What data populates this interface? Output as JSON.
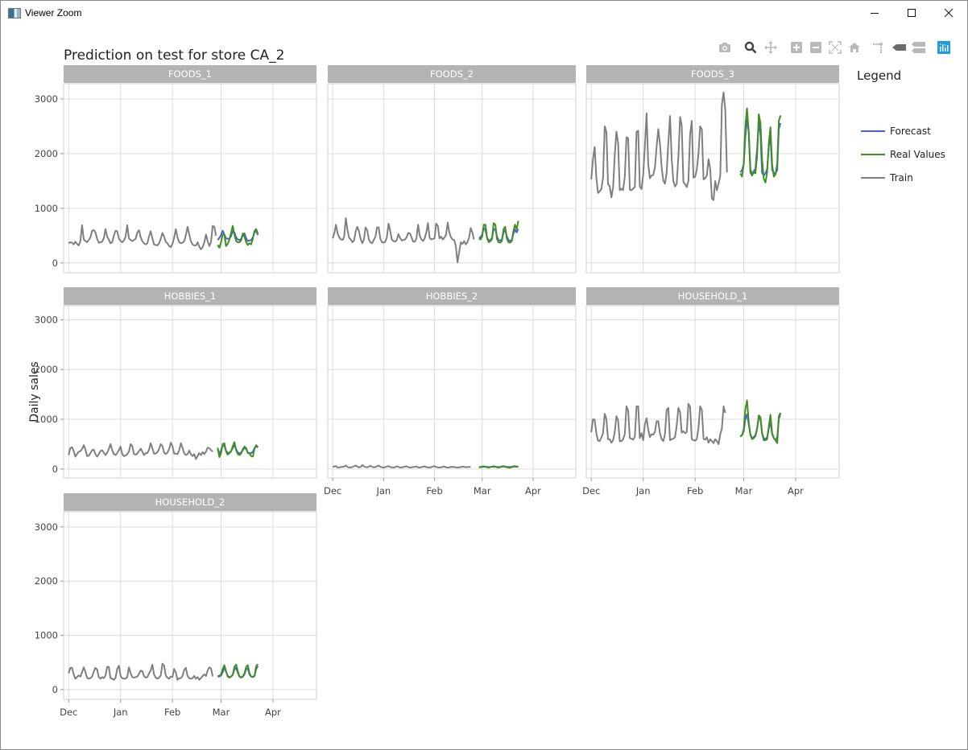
{
  "window": {
    "title": "Viewer Zoom",
    "controls": [
      "minimize",
      "maximize",
      "close"
    ]
  },
  "modebar": {
    "buttons": [
      {
        "name": "download-plot-icon",
        "title": "Download plot as png"
      },
      {
        "name": "zoom-icon",
        "title": "Zoom",
        "active": true
      },
      {
        "name": "pan-icon",
        "title": "Pan"
      },
      {
        "name": "zoom-in-icon",
        "title": "Zoom in"
      },
      {
        "name": "zoom-out-icon",
        "title": "Zoom out"
      },
      {
        "name": "autoscale-icon",
        "title": "Autoscale"
      },
      {
        "name": "reset-axes-icon",
        "title": "Reset axes"
      },
      {
        "name": "spike-lines-icon",
        "title": "Toggle Spike Lines"
      },
      {
        "name": "hover-closest-icon",
        "title": "Show closest data on hover"
      },
      {
        "name": "hover-compare-icon",
        "title": "Compare data on hover"
      },
      {
        "name": "plotly-logo-icon",
        "title": "Produced with Plotly"
      }
    ]
  },
  "colors": {
    "forecast": "#4a5fd6",
    "real": "#3f8f1f",
    "train": "#7f7f7f",
    "strip": "#b3b3b3",
    "grid": "#dcdcdc",
    "modebar_active": "#1f9bde"
  },
  "chart_data": {
    "type": "line",
    "title": "Prediction on test  for store CA_2",
    "ylabel": "Daily sales",
    "xlabel": "",
    "legend": {
      "title": "Legend",
      "position": "right",
      "entries": [
        "Forecast",
        "Real Values",
        "Train"
      ]
    },
    "x_axis": {
      "type": "date",
      "range": [
        "2015-11-28",
        "2016-04-27"
      ],
      "tick_labels": [
        "Dec",
        "Jan",
        "Feb",
        "Mar",
        "Apr"
      ],
      "tick_dates": [
        "2015-12-01",
        "2016-01-01",
        "2016-02-01",
        "2016-03-01",
        "2016-04-01"
      ]
    },
    "y_axis": {
      "range": [
        -180,
        3280
      ],
      "ticks": [
        0,
        1000,
        2000,
        3000
      ],
      "tick_labels": [
        "0",
        "1000",
        "2000",
        "3000"
      ]
    },
    "train_start": "2015-12-01",
    "test_start": "2016-02-28",
    "grid": true,
    "panels": [
      {
        "name": "FOODS_1",
        "train": [
          360,
          380,
          370,
          340,
          390,
          350,
          320,
          400,
          690,
          430,
          400,
          380,
          420,
          470,
          590,
          600,
          560,
          440,
          370,
          380,
          390,
          450,
          620,
          480,
          430,
          360,
          380,
          500,
          590,
          580,
          450,
          400,
          380,
          410,
          480,
          690,
          450,
          420,
          400,
          420,
          440,
          560,
          600,
          470,
          400,
          360,
          340,
          360,
          490,
          580,
          450,
          340,
          330,
          320,
          360,
          440,
          550,
          480,
          390,
          360,
          310,
          290,
          350,
          460,
          620,
          470,
          380,
          360,
          370,
          400,
          510,
          660,
          520,
          400,
          340,
          320,
          320,
          380,
          300,
          250,
          290,
          380,
          520,
          400,
          310,
          380,
          680,
          660,
          500
        ],
        "forecast": [
          420,
          460,
          510,
          590,
          520,
          450,
          440,
          450,
          490,
          580,
          560,
          470,
          430,
          420,
          440,
          500,
          540,
          450,
          400,
          410,
          420,
          470,
          560,
          590,
          510
        ],
        "real": [
          330,
          280,
          380,
          520,
          520,
          310,
          350,
          430,
          550,
          680,
          520,
          400,
          380,
          380,
          410,
          540,
          480,
          380,
          330,
          360,
          340,
          450,
          590,
          620,
          540
        ]
      },
      {
        "name": "FOODS_2",
        "train": [
          450,
          550,
          700,
          540,
          470,
          430,
          420,
          480,
          820,
          600,
          460,
          430,
          380,
          410,
          580,
          660,
          580,
          440,
          360,
          430,
          650,
          600,
          430,
          380,
          360,
          420,
          480,
          650,
          650,
          440,
          380,
          370,
          390,
          470,
          720,
          590,
          430,
          400,
          390,
          420,
          530,
          460,
          410,
          420,
          430,
          470,
          550,
          540,
          470,
          390,
          390,
          450,
          700,
          500,
          430,
          400,
          450,
          560,
          730,
          460,
          430,
          440,
          450,
          720,
          680,
          450,
          480,
          430,
          460,
          520,
          740,
          560,
          470,
          430,
          420,
          300,
          10,
          200,
          380,
          350,
          400,
          340,
          380,
          460,
          640,
          560,
          430
        ],
        "forecast": [
          460,
          470,
          520,
          640,
          600,
          460,
          410,
          420,
          460,
          620,
          620,
          480,
          420,
          410,
          430,
          560,
          600,
          490,
          420,
          400,
          420,
          530,
          610,
          560,
          620
        ],
        "real": [
          440,
          430,
          480,
          700,
          700,
          450,
          380,
          400,
          440,
          730,
          700,
          440,
          380,
          370,
          400,
          620,
          660,
          450,
          380,
          370,
          400,
          580,
          700,
          620,
          770
        ]
      },
      {
        "name": "FOODS_3",
        "train": [
          1530,
          1900,
          2120,
          1560,
          1280,
          1310,
          1350,
          1560,
          2500,
          2400,
          1450,
          1400,
          1200,
          1380,
          1980,
          2400,
          2200,
          1330,
          1360,
          1330,
          1570,
          2300,
          2280,
          1340,
          1330,
          1360,
          1390,
          2400,
          2420,
          1400,
          1350,
          1620,
          2150,
          2740,
          1810,
          1550,
          1600,
          1610,
          1750,
          2120,
          2450,
          2180,
          1750,
          1500,
          1450,
          1650,
          2200,
          2690,
          1900,
          1500,
          1400,
          1450,
          1950,
          2670,
          2520,
          1480,
          1440,
          1390,
          1500,
          2350,
          2600,
          1560,
          1580,
          1700,
          2000,
          2500,
          2450,
          1530,
          1550,
          1600,
          1900,
          1720,
          1180,
          1150,
          1500,
          1330,
          1450,
          1600,
          2900,
          3120,
          2800,
          1660
        ],
        "forecast": [
          1660,
          1700,
          1800,
          2300,
          2620,
          2400,
          1720,
          1620,
          1680,
          1720,
          2080,
          2600,
          2350,
          1650,
          1600,
          1640,
          1720,
          2150,
          2300,
          1700,
          1650,
          1640,
          1700,
          2450,
          2560
        ],
        "real": [
          1640,
          1580,
          1820,
          2500,
          2830,
          2400,
          1650,
          1600,
          1660,
          1640,
          1950,
          2720,
          2560,
          1900,
          1540,
          1470,
          1660,
          2200,
          2480,
          1800,
          1580,
          1620,
          1820,
          2600,
          2700
        ]
      },
      {
        "name": "HOBBIES_1",
        "train": [
          280,
          420,
          440,
          360,
          250,
          300,
          350,
          360,
          400,
          480,
          400,
          260,
          270,
          320,
          380,
          390,
          300,
          250,
          300,
          360,
          380,
          330,
          280,
          330,
          400,
          500,
          380,
          300,
          280,
          320,
          380,
          450,
          300,
          260,
          270,
          300,
          350,
          500,
          460,
          300,
          290,
          310,
          360,
          410,
          350,
          280,
          320,
          320,
          390,
          520,
          420,
          310,
          310,
          340,
          400,
          500,
          460,
          330,
          300,
          330,
          400,
          530,
          460,
          310,
          310,
          300,
          380,
          520,
          430,
          320,
          280,
          300,
          370,
          300,
          260,
          300,
          200,
          260,
          320,
          280,
          340,
          300,
          350,
          430,
          420,
          380,
          350
        ],
        "forecast": [
          400,
          310,
          380,
          480,
          460,
          370,
          320,
          330,
          360,
          420,
          480,
          400,
          330,
          320,
          330,
          380,
          430,
          400,
          330,
          320,
          320,
          350,
          420,
          460,
          430
        ],
        "real": [
          430,
          240,
          320,
          500,
          520,
          350,
          290,
          320,
          350,
          460,
          540,
          380,
          300,
          280,
          310,
          400,
          450,
          420,
          320,
          310,
          260,
          250,
          420,
          480,
          440
        ]
      },
      {
        "name": "HOBBIES_2",
        "train": [
          40,
          55,
          60,
          30,
          35,
          40,
          45,
          50,
          70,
          45,
          30,
          35,
          40,
          55,
          70,
          50,
          35,
          40,
          80,
          55,
          40,
          35,
          50,
          65,
          45,
          35,
          40,
          55,
          70,
          45,
          35,
          30,
          40,
          50,
          60,
          40,
          35,
          30,
          40,
          55,
          45,
          30,
          35,
          40,
          50,
          55,
          40,
          30,
          35,
          40,
          45,
          50,
          35,
          30,
          40,
          45,
          55,
          40,
          35,
          30,
          40,
          50,
          60,
          40,
          35,
          30,
          35,
          45,
          50,
          35,
          30,
          35,
          40,
          45,
          40,
          35,
          30,
          35,
          40,
          50,
          45,
          35,
          40,
          45,
          40
        ],
        "forecast": [
          45,
          40,
          42,
          45,
          48,
          42,
          40,
          42,
          45,
          50,
          48,
          42,
          40,
          42,
          45,
          48,
          50,
          44,
          40,
          42,
          44,
          48,
          50,
          48,
          52
        ],
        "real": [
          40,
          35,
          50,
          55,
          45,
          35,
          30,
          40,
          50,
          55,
          45,
          35,
          30,
          40,
          55,
          60,
          45,
          35,
          30,
          25,
          40,
          55,
          60,
          45,
          50
        ]
      },
      {
        "name": "HOUSEHOLD_1",
        "train": [
          740,
          1000,
          990,
          720,
          570,
          560,
          630,
          720,
          1110,
          1000,
          600,
          600,
          530,
          580,
          750,
          1060,
          980,
          560,
          560,
          600,
          700,
          1260,
          1170,
          620,
          610,
          590,
          650,
          1260,
          1260,
          620,
          720,
          580,
          900,
          1020,
          800,
          640,
          700,
          690,
          750,
          960,
          960,
          720,
          600,
          560,
          700,
          1190,
          1230,
          580,
          600,
          610,
          640,
          880,
          1230,
          1140,
          730,
          760,
          720,
          740,
          1310,
          1250,
          600,
          580,
          570,
          600,
          820,
          1260,
          1190,
          610,
          590,
          640,
          530,
          600,
          560,
          520,
          600,
          560,
          500,
          700,
          820,
          1260,
          1130
        ],
        "forecast": [
          660,
          680,
          760,
          1000,
          1100,
          900,
          700,
          620,
          640,
          680,
          820,
          1030,
          1000,
          720,
          620,
          600,
          640,
          820,
          950,
          700,
          620,
          580,
          640,
          1000,
          1120
        ],
        "real": [
          650,
          680,
          800,
          1200,
          1380,
          950,
          680,
          600,
          620,
          660,
          800,
          1080,
          1040,
          720,
          580,
          580,
          600,
          860,
          1090,
          720,
          620,
          580,
          520,
          1060,
          1130
        ]
      },
      {
        "name": "HOUSEHOLD_2",
        "train": [
          300,
          400,
          400,
          280,
          200,
          230,
          260,
          240,
          320,
          410,
          330,
          220,
          200,
          210,
          240,
          330,
          400,
          370,
          230,
          200,
          230,
          210,
          260,
          420,
          420,
          210,
          200,
          180,
          220,
          380,
          440,
          250,
          210,
          200,
          200,
          230,
          410,
          300,
          230,
          220,
          230,
          240,
          290,
          350,
          340,
          250,
          220,
          230,
          300,
          350,
          460,
          280,
          220,
          200,
          220,
          260,
          480,
          440,
          260,
          220,
          200,
          240,
          230,
          380,
          320,
          180,
          210,
          210,
          250,
          360,
          400,
          250,
          210,
          200,
          210,
          250,
          200,
          230,
          180,
          210,
          250,
          280,
          250,
          350,
          410,
          390,
          240
        ],
        "forecast": [
          240,
          240,
          260,
          320,
          400,
          330,
          250,
          230,
          240,
          270,
          370,
          400,
          310,
          240,
          230,
          240,
          280,
          380,
          390,
          280,
          240,
          230,
          250,
          380,
          430
        ],
        "real": [
          250,
          250,
          280,
          380,
          450,
          340,
          240,
          220,
          240,
          270,
          420,
          460,
          340,
          240,
          220,
          240,
          300,
          420,
          450,
          300,
          240,
          230,
          260,
          430,
          470
        ]
      }
    ]
  }
}
